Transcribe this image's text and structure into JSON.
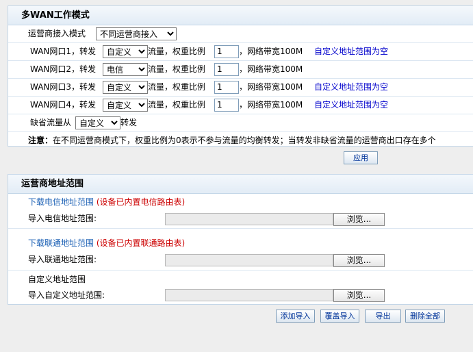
{
  "wan_panel": {
    "title": "多WAN工作模式",
    "access_mode": {
      "label": "运营商接入模式",
      "value": "不同运营商接入"
    },
    "rows": [
      {
        "prefix": "WAN网口1，转发",
        "select": "自定义",
        "suffix": "流量，权重比例",
        "weight": "1",
        "bandwidth": "，网络带宽100M",
        "link": "自定义地址范围为空"
      },
      {
        "prefix": "WAN网口2，转发",
        "select": "电信",
        "suffix": "流量，权重比例",
        "weight": "1",
        "bandwidth": "，网络带宽100M",
        "link": ""
      },
      {
        "prefix": "WAN网口3，转发",
        "select": "自定义",
        "suffix": "流量，权重比例",
        "weight": "1",
        "bandwidth": "，网络带宽100M",
        "link": "自定义地址范围为空"
      },
      {
        "prefix": "WAN网口4，转发",
        "select": "自定义",
        "suffix": "流量，权重比例",
        "weight": "1",
        "bandwidth": "，网络带宽100M",
        "link": "自定义地址范围为空"
      }
    ],
    "default_flow": {
      "prefix": "缺省流量从",
      "select": "自定义",
      "suffix": "转发"
    },
    "note_label": "注意：",
    "note_text": "在不同运营商模式下，权重比例为0表示不参与流量的均衡转发；当转发非缺省流量的运营商出口存在多个",
    "apply_label": "应用"
  },
  "isp_panel": {
    "title": "运营商地址范围",
    "telecom": {
      "link": "下载电信地址范围",
      "hint": "(设备已内置电信路由表)",
      "import_label": "导入电信地址范围:",
      "browse": "浏览..."
    },
    "unicom": {
      "link": "下载联通地址范围",
      "hint": "(设备已内置联通路由表)",
      "import_label": "导入联通地址范围:",
      "browse": "浏览..."
    },
    "custom": {
      "title": "自定义地址范围",
      "import_label": "导入自定义地址范围:",
      "browse": "浏览..."
    }
  },
  "bottom_buttons": {
    "add_import": "添加导入",
    "overwrite_import": "覆盖导入",
    "export": "导出",
    "delete_all": "删除全部"
  }
}
